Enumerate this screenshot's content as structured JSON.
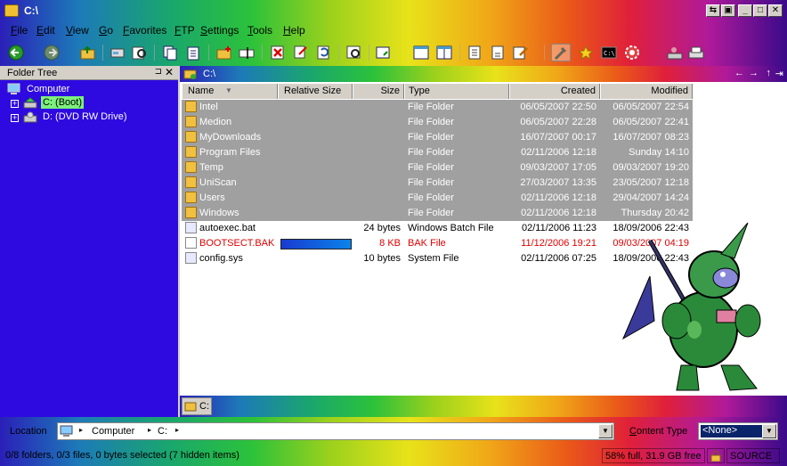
{
  "window": {
    "title": "C:\\",
    "controls": [
      "restore-small",
      "pin",
      "minimize",
      "maximize",
      "close"
    ]
  },
  "menu": [
    "File",
    "Edit",
    "View",
    "Go",
    "Favorites",
    "FTP",
    "Settings",
    "Tools",
    "Help"
  ],
  "sidebar": {
    "title": "Folder Tree",
    "root": "Computer",
    "items": [
      {
        "label": "C: (Boot)",
        "selected": true
      },
      {
        "label": "D: (DVD RW Drive)",
        "selected": false
      }
    ]
  },
  "pathbar": {
    "path": "C:\\"
  },
  "columns": [
    "Name",
    "Relative Size",
    "Size",
    "Type",
    "Created",
    "Modified"
  ],
  "files": [
    {
      "name": "Intel",
      "size": "",
      "type": "File Folder",
      "created": "06/05/2007 22:50",
      "modified": "06/05/2007 22:54",
      "kind": "folder",
      "selected": true
    },
    {
      "name": "Medion",
      "size": "",
      "type": "File Folder",
      "created": "06/05/2007 22:28",
      "modified": "06/05/2007 22:41",
      "kind": "folder",
      "selected": true
    },
    {
      "name": "MyDownloads",
      "size": "",
      "type": "File Folder",
      "created": "16/07/2007 00:17",
      "modified": "16/07/2007 08:23",
      "kind": "folder",
      "selected": true
    },
    {
      "name": "Program Files",
      "size": "",
      "type": "File Folder",
      "created": "02/11/2006 12:18",
      "modified": "Sunday 14:10",
      "kind": "folder",
      "selected": true
    },
    {
      "name": "Temp",
      "size": "",
      "type": "File Folder",
      "created": "09/03/2007 17:05",
      "modified": "09/03/2007 19:20",
      "kind": "folder",
      "selected": true
    },
    {
      "name": "UniScan",
      "size": "",
      "type": "File Folder",
      "created": "27/03/2007 13:35",
      "modified": "23/05/2007 12:18",
      "kind": "folder",
      "selected": true
    },
    {
      "name": "Users",
      "size": "",
      "type": "File Folder",
      "created": "02/11/2006 12:18",
      "modified": "29/04/2007 14:24",
      "kind": "folder",
      "selected": true
    },
    {
      "name": "Windows",
      "size": "",
      "type": "File Folder",
      "created": "02/11/2006 12:18",
      "modified": "Thursday 20:42",
      "kind": "folder",
      "selected": true
    },
    {
      "name": "autoexec.bat",
      "size": "24 bytes",
      "type": "Windows Batch File",
      "created": "02/11/2006 11:23",
      "modified": "18/09/2006 22:43",
      "kind": "bat",
      "selected": false
    },
    {
      "name": "BOOTSECT.BAK",
      "size": "8 KB",
      "type": "BAK File",
      "created": "11/12/2006 19:21",
      "modified": "09/03/2007 04:19",
      "kind": "bak",
      "selected": false,
      "relative_size": 1.0,
      "color": "#e00000"
    },
    {
      "name": "config.sys",
      "size": "10 bytes",
      "type": "System File",
      "created": "02/11/2006 07:25",
      "modified": "18/09/2006 22:43",
      "kind": "sys",
      "selected": false
    }
  ],
  "tab": {
    "label": "C:"
  },
  "location": {
    "label": "Location",
    "crumbs": [
      "Computer",
      "C:"
    ]
  },
  "content_type": {
    "label": "Content Type",
    "value": "<None>"
  },
  "status": {
    "text": "0/8 folders, 0/3 files, 0 bytes selected (7 hidden items)",
    "disk": "58% full, 31.9 GB free",
    "source": "SOURCE"
  }
}
